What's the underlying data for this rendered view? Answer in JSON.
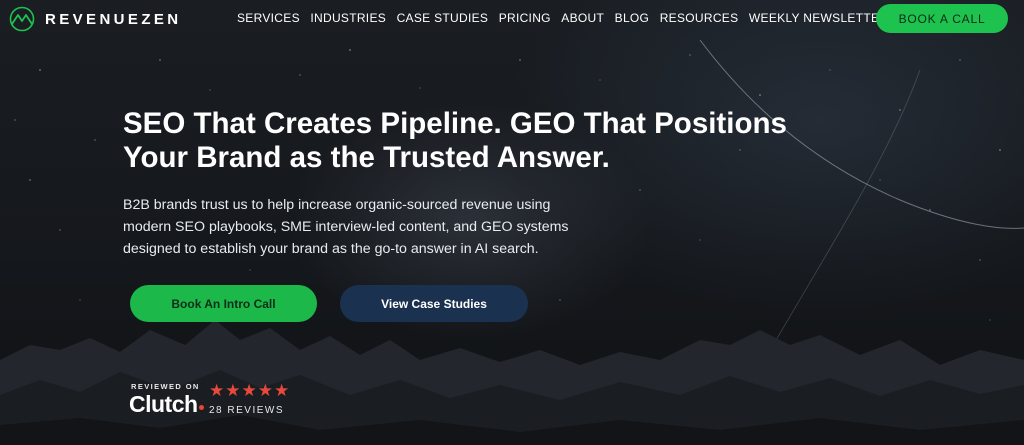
{
  "brand": {
    "name": "REVENUEZEN",
    "logo_icon": "mountain-logo-icon"
  },
  "nav": {
    "links": [
      "SERVICES",
      "INDUSTRIES",
      "CASE STUDIES",
      "PRICING",
      "ABOUT",
      "BLOG",
      "RESOURCES",
      "WEEKLY NEWSLETTER"
    ],
    "cta_label": "BOOK A CALL"
  },
  "hero": {
    "headline_line1": "SEO That Creates Pipeline. GEO That Positions",
    "headline_line2": "Your Brand as the Trusted Answer.",
    "subhead_line1": "B2B brands trust us to help increase organic-sourced revenue using",
    "subhead_line2": "modern SEO playbooks, SME interview-led content, and GEO systems",
    "subhead_line3": "designed to establish your brand as the go-to answer in AI search.",
    "primary_button": "Book An Intro Call",
    "secondary_button": "View Case Studies"
  },
  "clutch": {
    "reviewed_on": "REVIEWED ON",
    "logo_text": "Clutch",
    "stars": 5,
    "reviews": "28 REVIEWS"
  },
  "colors": {
    "accent_green": "#1ec34f",
    "navy_button": "#1b3150",
    "star_red": "#e8493d",
    "background": "#15181c"
  }
}
